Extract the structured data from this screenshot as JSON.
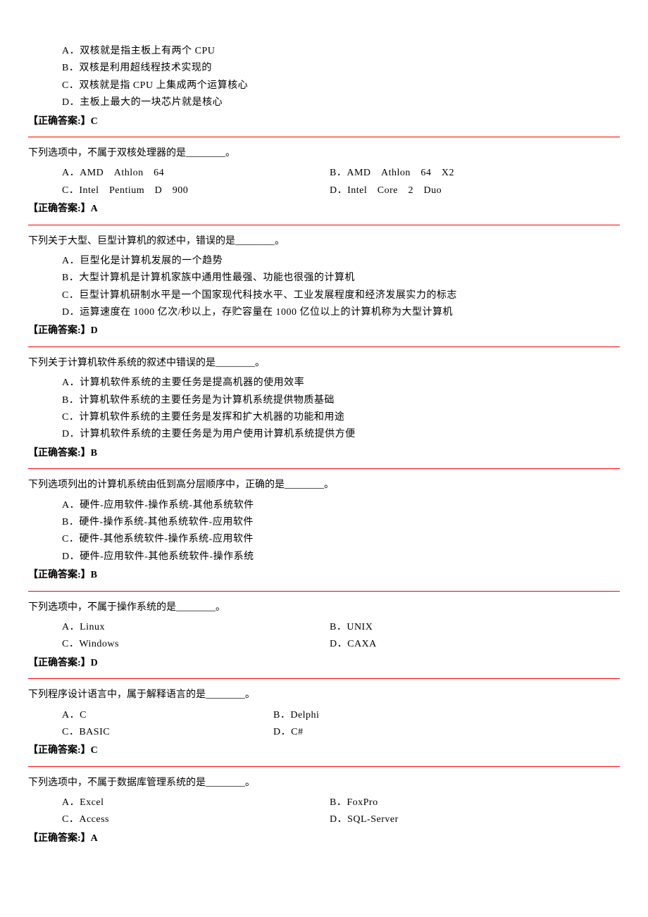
{
  "q1": {
    "options": {
      "a": "A．双核就是指主板上有两个 CPU",
      "b": "B．双核是利用超线程技术实现的",
      "c": "C．双核就是指 CPU 上集成两个运算核心",
      "d": "D．主板上最大的一块芯片就是核心"
    },
    "answer": "【正确答案:】C"
  },
  "q2": {
    "stem": "下列选项中，不属于双核处理器的是________。",
    "options": {
      "a": "A．AMD　Athlon　64",
      "b": "B．AMD　Athlon　64　X2",
      "c": "C．Intel　Pentium　D　900",
      "d": "D．Intel　Core　2　Duo"
    },
    "answer": "【正确答案:】A"
  },
  "q3": {
    "stem": "下列关于大型、巨型计算机的叙述中，错误的是________。",
    "options": {
      "a": "A．巨型化是计算机发展的一个趋势",
      "b": "B．大型计算机是计算机家族中通用性最强、功能也很强的计算机",
      "c": "C．巨型计算机研制水平是一个国家现代科技水平、工业发展程度和经济发展实力的标志",
      "d": "D．运算速度在 1000 亿次/秒以上，存贮容量在 1000 亿位以上的计算机称为大型计算机"
    },
    "answer": "【正确答案:】D"
  },
  "q4": {
    "stem": "下列关于计算机软件系统的叙述中错误的是________。",
    "options": {
      "a": "A．计算机软件系统的主要任务是提高机器的使用效率",
      "b": "B．计算机软件系统的主要任务是为计算机系统提供物质基础",
      "c": "C．计算机软件系统的主要任务是发挥和扩大机器的功能和用途",
      "d": "D．计算机软件系统的主要任务是为用户使用计算机系统提供方便"
    },
    "answer": "【正确答案:】B"
  },
  "q5": {
    "stem": "下列选项列出的计算机系统由低到高分层顺序中，正确的是________。",
    "options": {
      "a": "A．硬件-应用软件-操作系统-其他系统软件",
      "b": "B．硬件-操作系统-其他系统软件-应用软件",
      "c": "C．硬件-其他系统软件-操作系统-应用软件",
      "d": "D．硬件-应用软件-其他系统软件-操作系统"
    },
    "answer": "【正确答案:】B"
  },
  "q6": {
    "stem": "下列选项中，不属于操作系统的是________。",
    "options": {
      "a": "A．Linux",
      "b": "B．UNIX",
      "c": "C．Windows",
      "d": "D．CAXA"
    },
    "answer": "【正确答案:】D"
  },
  "q7": {
    "stem": "下列程序设计语言中，属于解释语言的是________。",
    "options": {
      "a": "A．C",
      "b": "B．Delphi",
      "c": "C．BASIC",
      "d": "D．C#"
    },
    "answer": "【正确答案:】C"
  },
  "q8": {
    "stem": "下列选项中，不属于数据库管理系统的是________。",
    "options": {
      "a": "A．Excel",
      "b": "B．FoxPro",
      "c": "C．Access",
      "d": "D．SQL-Server"
    },
    "answer": "【正确答案:】A"
  }
}
